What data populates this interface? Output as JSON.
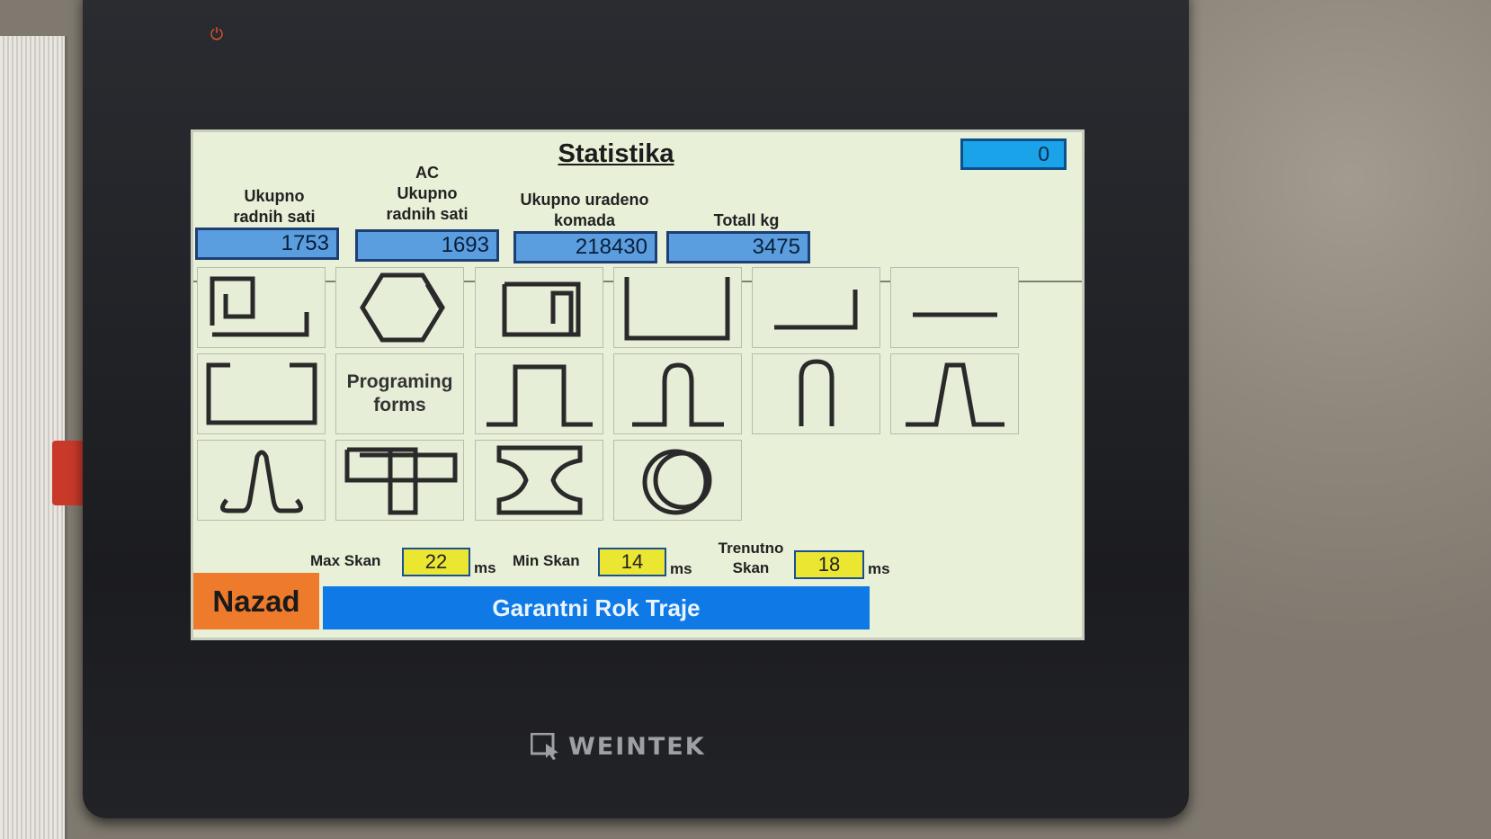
{
  "screen": {
    "title": "Statistika",
    "top_counter": "0"
  },
  "stats": [
    {
      "label": "Ukupno\nradnih sati",
      "value": "1753"
    },
    {
      "label": "AC\nUkupno\nradnih sati",
      "value": "1693"
    },
    {
      "label": "Ukupno uradeno\nkomada",
      "value": "218430"
    },
    {
      "label": "Totall kg",
      "value": "3475"
    }
  ],
  "shapes": [
    "spiral-hook-shape-icon",
    "hexagon-shape-icon",
    "square-spiral-shape-icon",
    "u-channel-shape-icon",
    "l-bend-shape-icon",
    "straight-bar-shape-icon",
    "open-rectangle-shape-icon",
    "programming-forms",
    "hat-profile-shape-icon",
    "narrow-hat-profile-shape-icon",
    "u-hairpin-shape-icon",
    "trapezoid-hat-shape-icon",
    "omega-hook-shape-icon",
    "double-rectangle-shape-icon",
    "i-beam-shape-icon",
    "coil-ring-shape-icon"
  ],
  "programming_forms_label": "Programing\nforms",
  "scan": {
    "max_label": "Max Skan",
    "max_value": "22",
    "max_unit": "ms",
    "min_label": "Min Skan",
    "min_value": "14",
    "min_unit": "ms",
    "current_label": "Trenutno\nSkan",
    "current_value": "18",
    "current_unit": "ms"
  },
  "back_label": "Nazad",
  "warranty_text": "Garantni Rok Traje",
  "brand_name": "WEINTEK",
  "colors": {
    "screen_bg": "#e9f0d8",
    "stat_field": "#5a9ee0",
    "scan_field": "#ebe632",
    "back_button": "#ee7b2b",
    "banner": "#0f7ae6"
  }
}
